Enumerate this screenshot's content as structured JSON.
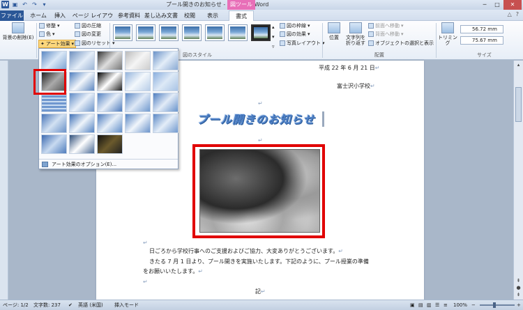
{
  "titlebar": {
    "title": "プール開きのお知らせ - Microsoft Word",
    "context_tab_group": "図ツール"
  },
  "tabs": [
    {
      "label": "ファイル"
    },
    {
      "label": "ホーム"
    },
    {
      "label": "挿入"
    },
    {
      "label": "ページ レイアウト"
    },
    {
      "label": "参考資料"
    },
    {
      "label": "差し込み文書"
    },
    {
      "label": "校閲"
    },
    {
      "label": "表示"
    },
    {
      "label": "書式"
    }
  ],
  "ribbon": {
    "remove_background": "背景の削除(E)",
    "corrections": "修整",
    "color": "色",
    "artistic_effects": "アート効果",
    "compress": "図の圧縮",
    "change_picture": "図の変更",
    "reset_picture": "図のリセット",
    "picture_styles_group": "図のスタイル",
    "picture_border": "図の枠線",
    "picture_effects": "図の効果",
    "picture_layout": "写真レイアウト",
    "position": "位置",
    "wrap_text": "文字列を折り返す",
    "bring_forward": "前面へ移動",
    "send_backward": "背面へ移動",
    "selection_pane": "オブジェクトの選択と表示",
    "arrange_group": "配置",
    "crop": "トリミング",
    "height": "56.72 mm",
    "width": "75.67 mm",
    "size_group": "サイズ"
  },
  "dropdown": {
    "options_label": "アート効果のオプション(E)..."
  },
  "document": {
    "date": "平成 22 年 6 月 21 日",
    "school": "富士沢小学校",
    "title": "プール開きのお知らせ",
    "para1": "日ごろから学校行事へのご支援およびご協力、大変ありがとうございます。",
    "para2a": "きたる 7 月 1 日より、プール開きを実施いたします。下記のように、プール授業の準備",
    "para2b": "をお願いいたします。",
    "ki": "記"
  },
  "status": {
    "page": "ページ: 1/2",
    "words": "文字数: 237",
    "language": "英語 (米国)",
    "mode": "挿入モード",
    "zoom": "100%"
  },
  "colors": {
    "highlight_frame": "#e10000",
    "file_tab": "#2b5797",
    "context_tab": "#e86fb8"
  }
}
